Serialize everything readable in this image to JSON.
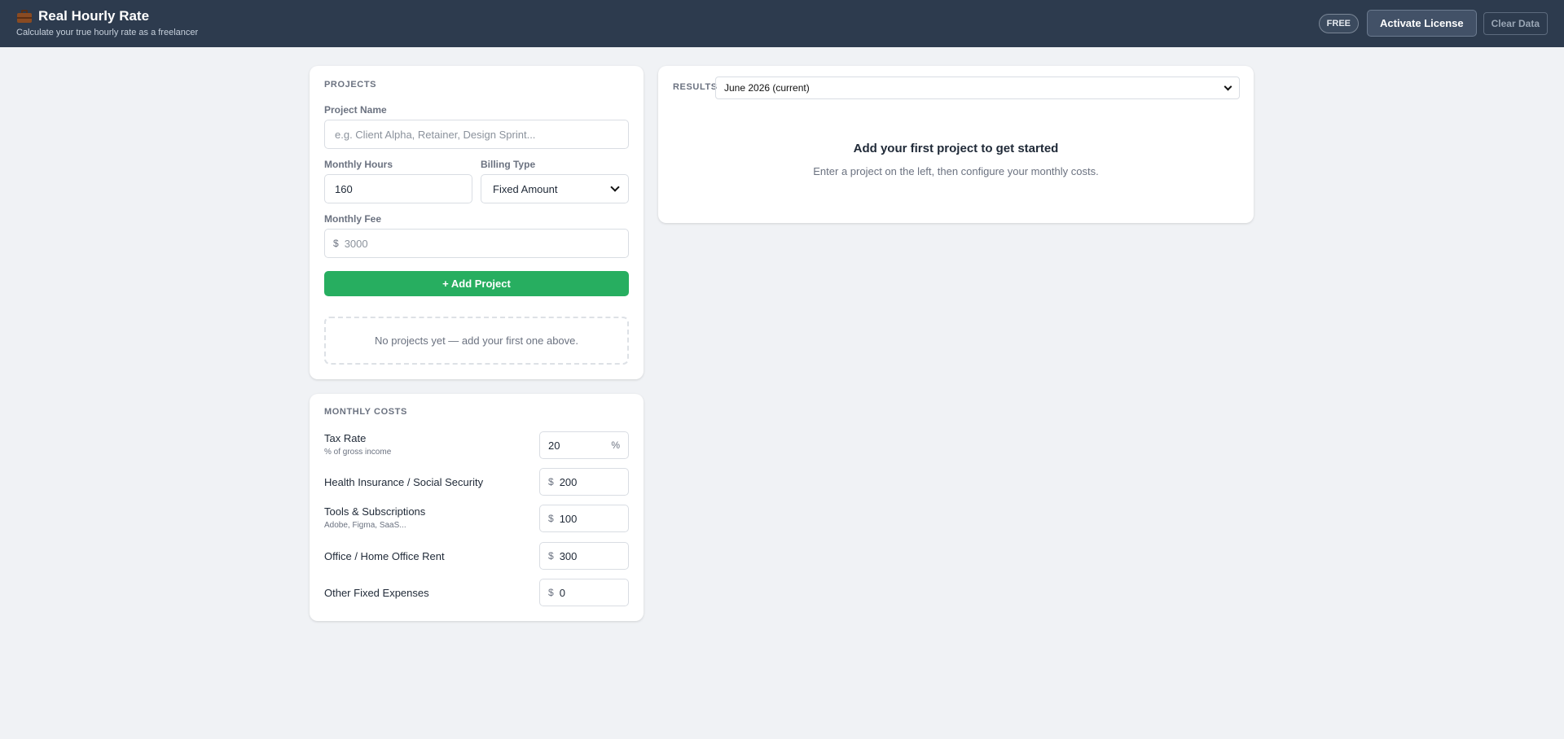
{
  "header": {
    "title": "Real Hourly Rate",
    "subtitle": "Calculate your true hourly rate as a freelancer",
    "logo_icon": "briefcase-icon",
    "badge": "FREE",
    "activate_label": "Activate License",
    "clear_label": "Clear Data"
  },
  "projects": {
    "section_title": "PROJECTS",
    "name_label": "Project Name",
    "name_placeholder": "e.g. Client Alpha, Retainer, Design Sprint...",
    "hours_label": "Monthly Hours",
    "hours_value": "160",
    "billing_label": "Billing Type",
    "billing_value": "Fixed Amount",
    "fee_label": "Monthly Fee",
    "fee_prefix": "$",
    "fee_placeholder": "3000",
    "add_button": "+ Add Project",
    "empty_message": "No projects yet — add your first one above."
  },
  "costs": {
    "section_title": "MONTHLY COSTS",
    "items": [
      {
        "label": "Tax Rate",
        "hint": "% of gross income",
        "value": "20",
        "suffix": "%"
      },
      {
        "label": "Health Insurance / Social Security",
        "prefix": "$",
        "value": "200"
      },
      {
        "label": "Tools & Subscriptions",
        "hint": "Adobe, Figma, SaaS...",
        "prefix": "$",
        "value": "100"
      },
      {
        "label": "Office / Home Office Rent",
        "prefix": "$",
        "value": "300"
      },
      {
        "label": "Other Fixed Expenses",
        "prefix": "$",
        "value": "0"
      }
    ]
  },
  "results": {
    "label": "RESULTS",
    "month_selected": "June 2026 (current)",
    "empty_title": "Add your first project to get started",
    "empty_subtitle": "Enter a project on the left, then configure your monthly costs."
  },
  "colors": {
    "header_bg": "#2d3b4e",
    "accent_green": "#27ae60",
    "page_bg": "#f0f2f5"
  }
}
